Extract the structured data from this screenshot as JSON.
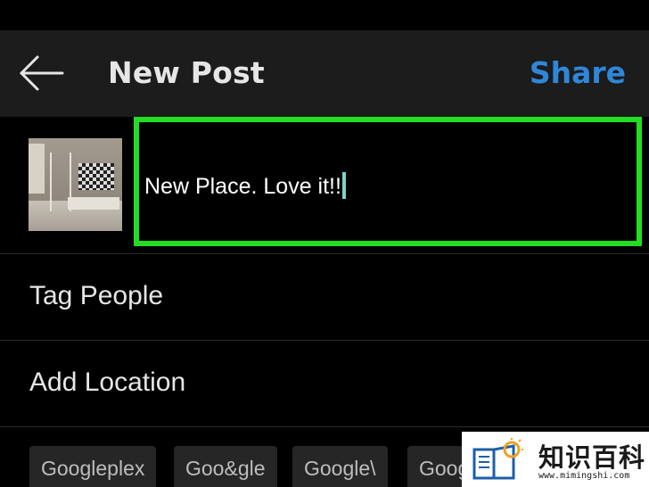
{
  "header": {
    "title": "New Post",
    "share_label": "Share",
    "back_icon": "arrow-left-icon"
  },
  "post": {
    "thumbnail_icon": "photo-thumbnail",
    "caption": "New Place. Love it!!",
    "highlight_color": "#22dd22"
  },
  "options": [
    {
      "label": "Tag People"
    },
    {
      "label": "Add Location"
    }
  ],
  "location_suggestions": [
    {
      "label": "Googleplex"
    },
    {
      "label": "Goo&gle"
    },
    {
      "label": "Google\\"
    },
    {
      "label": "Goog"
    }
  ],
  "watermark": {
    "name": "知识百科",
    "url": "www.mimingshi.com"
  },
  "colors": {
    "accent": "#2f87d9",
    "header_bg": "#1c1c1c",
    "background": "#000000"
  }
}
